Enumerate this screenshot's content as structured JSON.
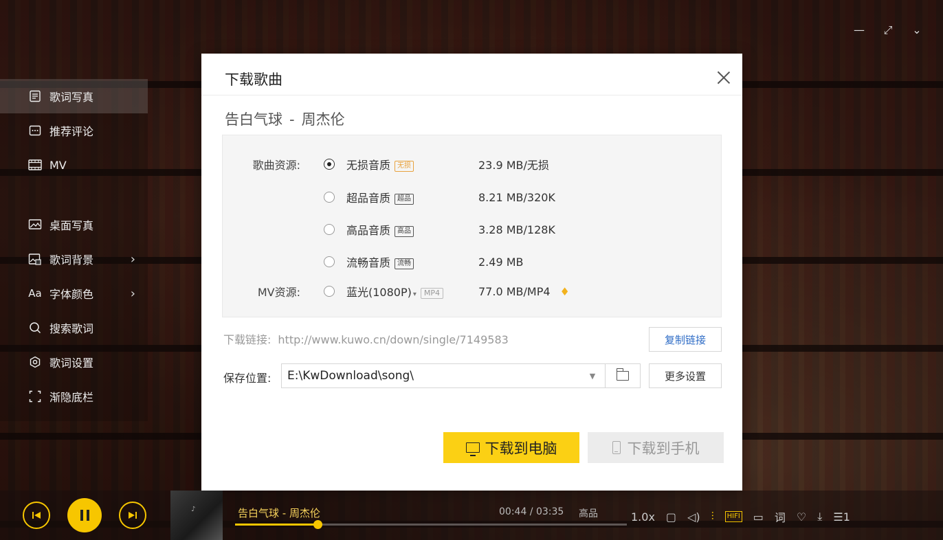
{
  "window_controls": {
    "minimize": "—",
    "fullscreen": "⤢",
    "collapse": "⌄"
  },
  "left_menu": {
    "items": [
      {
        "label": "歌词写真"
      },
      {
        "label": "推荐评论"
      },
      {
        "label": "MV"
      },
      {
        "label": "桌面写真"
      },
      {
        "label": "歌词背景"
      },
      {
        "label": "字体颜色"
      },
      {
        "label": "搜索歌词"
      },
      {
        "label": "歌词设置"
      },
      {
        "label": "渐隐底栏"
      }
    ],
    "font_color_icon_text": "Aa"
  },
  "dialog": {
    "title": "下载歌曲",
    "song": "告白气球",
    "sep": "-",
    "artist": "周杰伦",
    "song_source_label": "歌曲资源:",
    "mv_source_label": "MV资源:",
    "qualities": [
      {
        "name": "无损音质",
        "badge": "无损",
        "size": "23.9 MB/无损",
        "selected": true
      },
      {
        "name": "超品音质",
        "badge": "超品",
        "size": "8.21 MB/320K",
        "selected": false
      },
      {
        "name": "高品音质",
        "badge": "高品",
        "size": "3.28 MB/128K",
        "selected": false
      },
      {
        "name": "流畅音质",
        "badge": "流畅",
        "size": "2.49 MB",
        "selected": false
      }
    ],
    "mv": {
      "name": "蓝光(1080P)",
      "dropdown": "▾",
      "badge": "MP4",
      "size": "77.0 MB/MP4"
    },
    "link_label": "下载链接:",
    "link_url": "http://www.kuwo.cn/down/single/7149583",
    "copy_button": "复制链接",
    "save_label": "保存位置:",
    "save_path": "E:\\KwDownload\\song\\",
    "more_settings": "更多设置",
    "download_pc": "下载到电脑",
    "download_phone": "下载到手机"
  },
  "player": {
    "now_playing": "告白气球 - 周杰伦",
    "time": "00:44 / 03:35",
    "quality": "高品",
    "speed": "1.0x",
    "hifi": "HIFI",
    "lyrics_btn": "词",
    "playlist_count": "1",
    "progress": 0.21,
    "colors": {
      "accent": "#f7c600",
      "download_btn": "#fbd014"
    }
  }
}
